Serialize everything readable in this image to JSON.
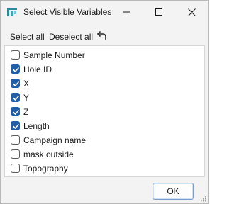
{
  "window": {
    "title": "Select Visible Variables",
    "accent_color": "#1f5fa8"
  },
  "toolbar": {
    "select_all_label": "Select all",
    "deselect_all_label": "Deselect all",
    "undo_icon": "undo-icon"
  },
  "variables": [
    {
      "label": "Sample Number",
      "checked": false
    },
    {
      "label": "Hole ID",
      "checked": true
    },
    {
      "label": "X",
      "checked": true
    },
    {
      "label": "Y",
      "checked": true
    },
    {
      "label": "Z",
      "checked": true
    },
    {
      "label": "Length",
      "checked": true
    },
    {
      "label": "Campaign name",
      "checked": false
    },
    {
      "label": "mask outside",
      "checked": false
    },
    {
      "label": "Topography",
      "checked": false
    }
  ],
  "footer": {
    "ok_label": "OK"
  }
}
